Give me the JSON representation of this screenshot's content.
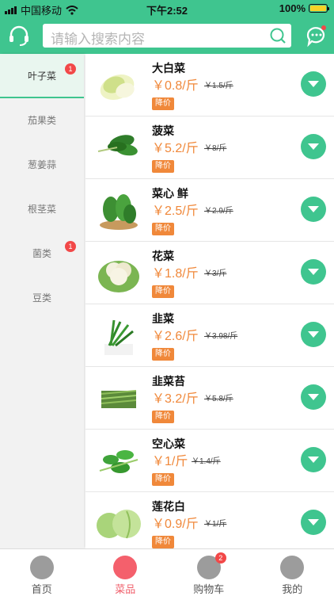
{
  "status_bar": {
    "carrier": "中国移动",
    "time": "下午2:52",
    "battery": "100%"
  },
  "header": {
    "search_placeholder": "请输入搜索内容"
  },
  "sidebar": {
    "categories": [
      {
        "label": "叶子菜",
        "badge": "1"
      },
      {
        "label": "茄果类",
        "badge": ""
      },
      {
        "label": "葱姜蒜",
        "badge": ""
      },
      {
        "label": "根茎菜",
        "badge": ""
      },
      {
        "label": "菌类",
        "badge": "1"
      },
      {
        "label": "豆类",
        "badge": ""
      }
    ]
  },
  "products": [
    {
      "name": "大白菜",
      "price": "￥0.8/斤",
      "original": "￥1.5/斤",
      "tag": "降价"
    },
    {
      "name": "菠菜",
      "price": "￥5.2/斤",
      "original": "￥8/斤",
      "tag": "降价"
    },
    {
      "name": "菜心 鲜",
      "price": "￥2.5/斤",
      "original": "￥2.9/斤",
      "tag": "降价"
    },
    {
      "name": "花菜",
      "price": "￥1.8/斤",
      "original": "￥3/斤",
      "tag": "降价"
    },
    {
      "name": "韭菜",
      "price": "￥2.6/斤",
      "original": "￥3.98/斤",
      "tag": "降价"
    },
    {
      "name": "韭菜苔",
      "price": "￥3.2/斤",
      "original": "￥5.8/斤",
      "tag": "降价"
    },
    {
      "name": "空心菜",
      "price": "￥1/斤",
      "original": "￥1.4/斤",
      "tag": "降价"
    },
    {
      "name": "莲花白",
      "price": "￥0.9/斤",
      "original": "￥1/斤",
      "tag": "降价"
    }
  ],
  "tabbar": {
    "tabs": [
      {
        "label": "首页",
        "badge": ""
      },
      {
        "label": "菜品",
        "badge": ""
      },
      {
        "label": "购物车",
        "badge": "2"
      },
      {
        "label": "我的",
        "badge": ""
      }
    ]
  },
  "colors": {
    "primary": "#3fc58f",
    "price": "#f0883a",
    "badge": "#f24848",
    "active_tab": "#f4606c"
  }
}
